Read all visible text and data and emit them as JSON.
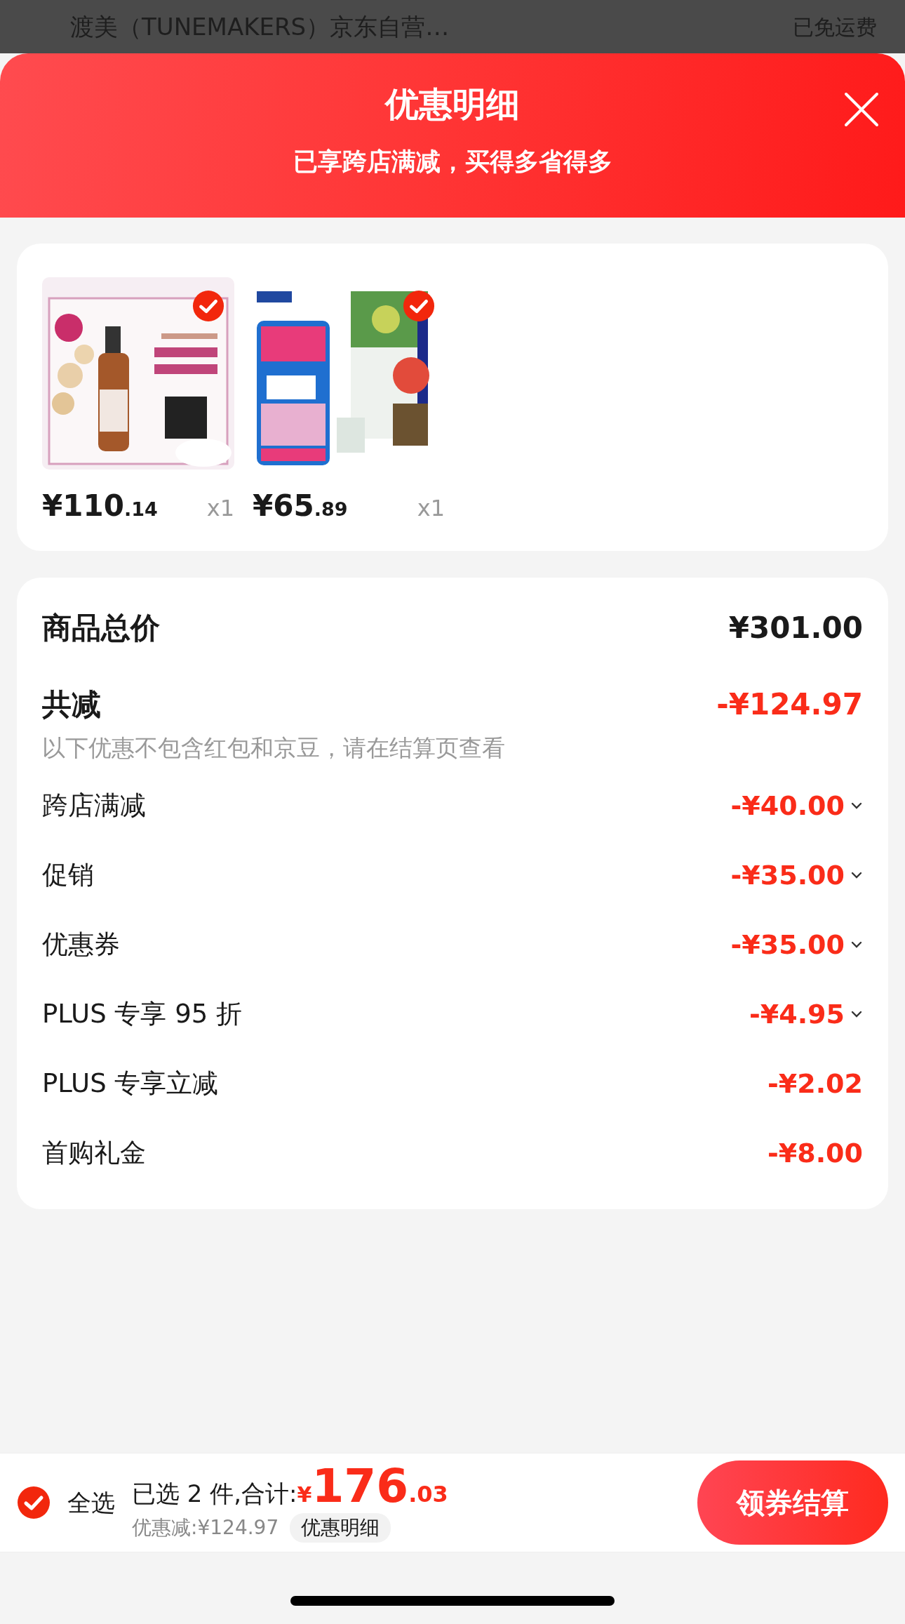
{
  "backdrop": {
    "store_name": "渡美（TUNEMAKERS）京东自营…",
    "shipping": "已免运费"
  },
  "sheet": {
    "title": "优惠明细",
    "subtitle": "已享跨店满减，买得多省得多"
  },
  "products": [
    {
      "selected": true,
      "currency": "¥",
      "price_main": "110",
      "price_decimal": ".14",
      "quantity": "x1"
    },
    {
      "selected": true,
      "currency": "¥",
      "price_main": "65",
      "price_decimal": ".89",
      "quantity": "x1"
    }
  ],
  "summary": {
    "total_label": "商品总价",
    "total_value": "¥301.00",
    "reduce_label": "共减",
    "reduce_value": "-¥124.97",
    "note": "以下优惠不包含红包和京豆，请在结算页查看",
    "items": [
      {
        "label": "跨店满减",
        "amount": "-¥40.00",
        "expandable": true
      },
      {
        "label": "促销",
        "amount": "-¥35.00",
        "expandable": true
      },
      {
        "label": "优惠券",
        "amount": "-¥35.00",
        "expandable": true
      },
      {
        "label": "PLUS 专享 95 折",
        "amount": "-¥4.95",
        "expandable": true
      },
      {
        "label": "PLUS 专享立减",
        "amount": "-¥2.02",
        "expandable": false
      },
      {
        "label": "首购礼金",
        "amount": "-¥8.00",
        "expandable": false
      }
    ]
  },
  "footer": {
    "select_all": {
      "label": "全选",
      "selected": true
    },
    "selected_text": "已选 2 件,合计:",
    "currency": "¥",
    "total_main": "176",
    "total_decimal": ".03",
    "saved": "优惠减:¥124.97",
    "detail_link": "优惠明细",
    "checkout": "领券结算"
  }
}
